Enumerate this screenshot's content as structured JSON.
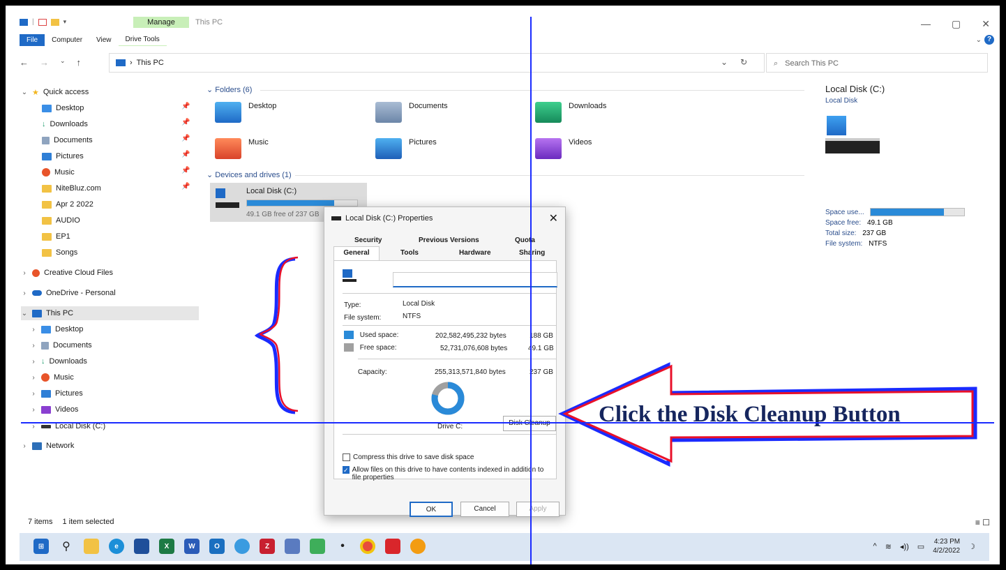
{
  "window": {
    "title": "This PC",
    "manage_tab": "Manage",
    "ribbon_tabs": [
      "File",
      "Computer",
      "View",
      "Drive Tools"
    ],
    "controls": [
      "—",
      "▢",
      "✕"
    ]
  },
  "address": {
    "breadcrumb": "This PC",
    "search_placeholder": "Search This PC"
  },
  "navpane": {
    "quick_access": "Quick access",
    "quick_items": [
      "Desktop",
      "Downloads",
      "Documents",
      "Pictures",
      "Music",
      "NiteBluz.com",
      "Apr 2 2022",
      "AUDIO",
      "EP1",
      "Songs"
    ],
    "creative_cloud": "Creative Cloud Files",
    "onedrive": "OneDrive - Personal",
    "this_pc": "This PC",
    "pc_items": [
      "Desktop",
      "Documents",
      "Downloads",
      "Music",
      "Pictures",
      "Videos",
      "Local Disk (C:)"
    ],
    "network": "Network"
  },
  "content": {
    "folders_header": "Folders (6)",
    "folders": [
      "Desktop",
      "Documents",
      "Downloads",
      "Music",
      "Pictures",
      "Videos"
    ],
    "devices_header": "Devices and drives (1)",
    "drive_name": "Local Disk (C:)",
    "drive_free": "49.1 GB free of 237 GB",
    "drive_used_fraction": 0.79
  },
  "details": {
    "title": "Local Disk (C:)",
    "subtitle": "Local Disk",
    "space_used_label": "Space use...",
    "space_free_label": "Space free:",
    "space_free": "49.1 GB",
    "total_size_label": "Total size:",
    "total_size": "237 GB",
    "fs_label": "File system:",
    "fs": "NTFS"
  },
  "status": {
    "items": "7 items",
    "selected": "1 item selected"
  },
  "taskbar": {
    "time": "4:23 PM",
    "date": "4/2/2022"
  },
  "dialog": {
    "title": "Local Disk (C:) Properties",
    "tabs_top": [
      "Security",
      "Previous Versions",
      "Quota"
    ],
    "tabs_bottom": [
      "General",
      "Tools",
      "Hardware",
      "Sharing"
    ],
    "label_value": "",
    "type_label": "Type:",
    "type": "Local Disk",
    "fs_label": "File system:",
    "fs": "NTFS",
    "used_label": "Used space:",
    "used_bytes": "202,582,495,232 bytes",
    "used_gb": "188 GB",
    "free_label": "Free space:",
    "free_bytes": "52,731,076,608 bytes",
    "free_gb": "49.1 GB",
    "capacity_label": "Capacity:",
    "capacity_bytes": "255,313,571,840 bytes",
    "capacity_gb": "237 GB",
    "drive_label": "Drive C:",
    "disk_cleanup": "Disk Cleanup",
    "compress_label": "Compress this drive to save disk space",
    "index_label": "Allow files on this drive to have contents indexed in addition to file properties",
    "ok": "OK",
    "cancel": "Cancel",
    "apply": "Apply"
  },
  "annotation": {
    "callout": "Click the Disk Cleanup Button"
  }
}
